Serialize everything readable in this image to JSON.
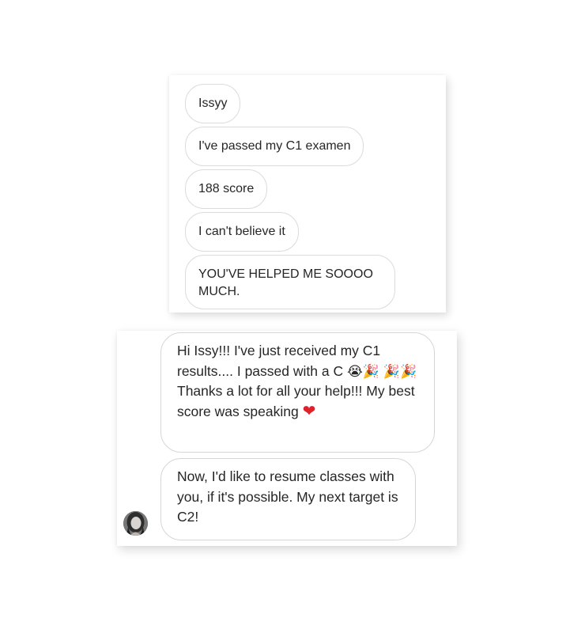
{
  "thread_top": {
    "messages": [
      {
        "text": "Issyy"
      },
      {
        "text": "I've passed my C1 examen"
      },
      {
        "text": "188 score"
      },
      {
        "text": "I can't believe it"
      },
      {
        "text": "YOU'VE HELPED ME SOOOO MUCH."
      }
    ]
  },
  "thread_bottom": {
    "message1": {
      "part1": "Hi Issy!!! I've just received my C1 results.... I passed with a C ",
      "emoji_cry": "😭",
      "emoji_party1": "🎉",
      "emoji_party2": "🎉",
      "emoji_party3": "🎉",
      "part2": " Thanks a lot for all your help!!! My best score was speaking",
      "emoji_heart": "❤"
    },
    "message2": {
      "text": "Now, I'd like to resume classes with you, if it's possible. My next target is C2!"
    }
  },
  "icons": {
    "avatar": "user-avatar"
  }
}
